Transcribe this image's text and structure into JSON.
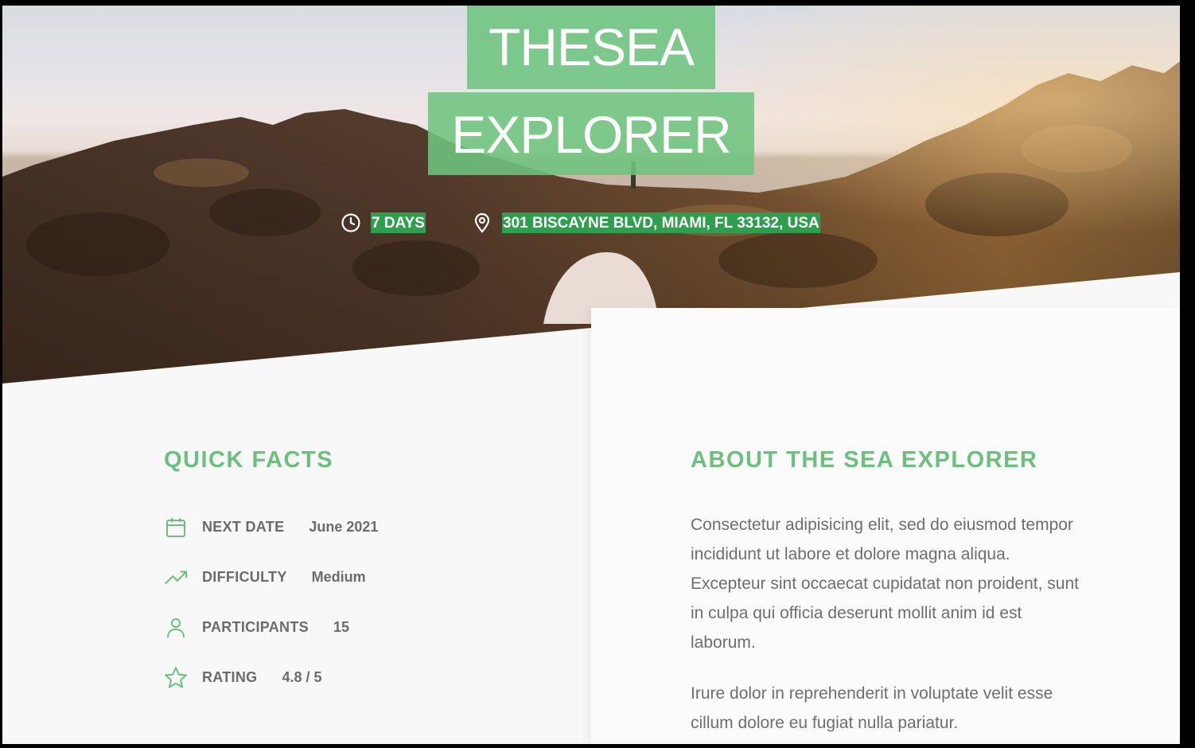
{
  "hero": {
    "title_line1": "THESEA",
    "title_line2": "EXPLORER",
    "duration": "7 DAYS",
    "address": "301 BISCAYNE BLVD, MIAMI, FL 33132, USA",
    "duration_icon": "clock-icon",
    "address_icon": "location-pin-icon"
  },
  "quick_facts": {
    "title": "QUICK FACTS",
    "items": [
      {
        "icon": "calendar-icon",
        "label": "NEXT DATE",
        "value": "June 2021"
      },
      {
        "icon": "trending-up-icon",
        "label": "DIFFICULTY",
        "value": "Medium"
      },
      {
        "icon": "user-icon",
        "label": "PARTICIPANTS",
        "value": "15"
      },
      {
        "icon": "star-icon",
        "label": "RATING",
        "value": "4.8 / 5"
      }
    ]
  },
  "about": {
    "title": "ABOUT THE SEA EXPLORER",
    "paragraph1": "Consectetur adipisicing elit, sed do eiusmod tempor incididunt ut labore et dolore magna aliqua. Excepteur sint occaecat cupidatat non proident, sunt in culpa qui officia deserunt mollit anim id est laborum.",
    "paragraph2": "Irure dolor in reprehenderit in voluptate velit esse cillum dolore eu fugiat nulla pariatur."
  },
  "colors": {
    "accent": "#6cbf7f",
    "tag_bg": "#2f9e4f",
    "text": "#6e6e6e"
  }
}
